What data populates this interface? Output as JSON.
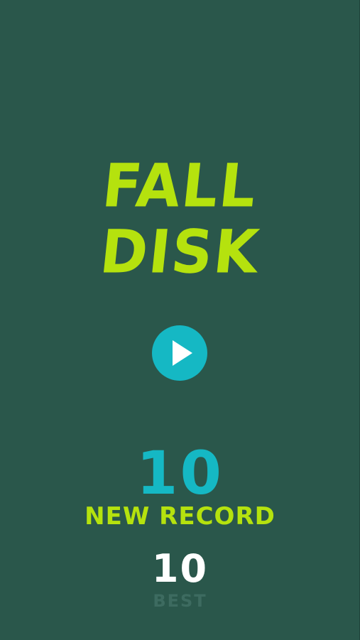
{
  "game": {
    "title_line_1": "FALL",
    "title_line_2": "DISK"
  },
  "controls": {
    "play_icon": "play-icon"
  },
  "scores": {
    "current": "10",
    "record_label": "NEW RECORD",
    "best": "10",
    "best_label": "BEST"
  },
  "colors": {
    "background": "#2a574b",
    "title": "#b5e20e",
    "accent_cyan": "#15b8c4",
    "record_label": "#b5e20e",
    "best_score": "#ffffff",
    "best_label": "#3d6b60"
  }
}
